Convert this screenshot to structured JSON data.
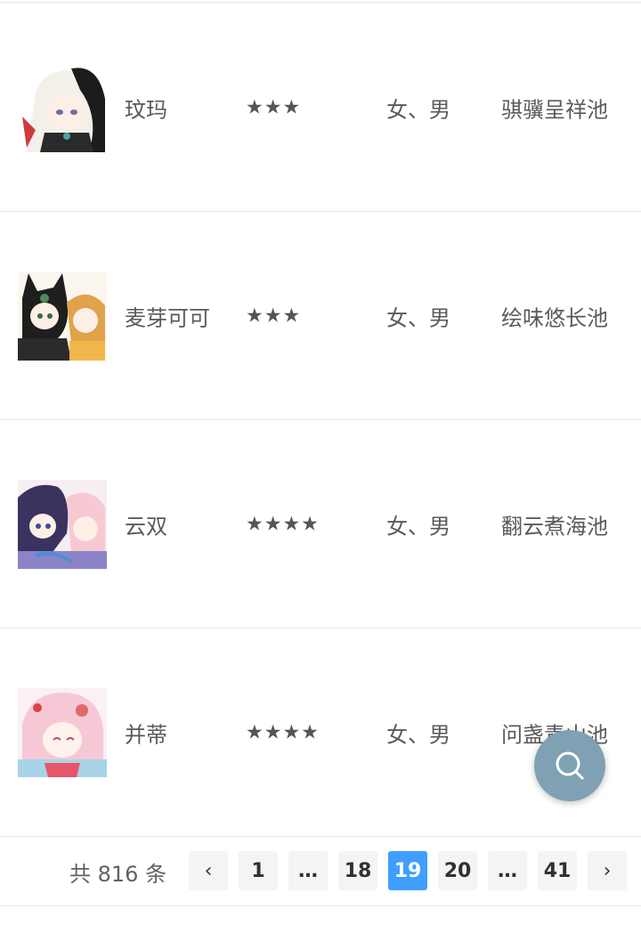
{
  "rows": [
    {
      "name": "玟玛",
      "stars": "★★★",
      "gender": "女、男",
      "pool": "骐骥呈祥池"
    },
    {
      "name": "麦芽可可",
      "stars": "★★★",
      "gender": "女、男",
      "pool": "绘味悠长池"
    },
    {
      "name": "云双",
      "stars": "★★★★",
      "gender": "女、男",
      "pool": "翻云煮海池"
    },
    {
      "name": "并蒂",
      "stars": "★★★★",
      "gender": "女、男",
      "pool": "问盏青山池"
    }
  ],
  "pagination": {
    "total_text": "共 816 条",
    "prev_label": "‹",
    "next_label": "›",
    "pages": [
      "1",
      "…",
      "18",
      "19",
      "20",
      "…",
      "41"
    ],
    "current": "19"
  },
  "colors": {
    "accent": "#409eff",
    "fab": "#7fa1b3"
  },
  "fab_icon": "search-icon"
}
